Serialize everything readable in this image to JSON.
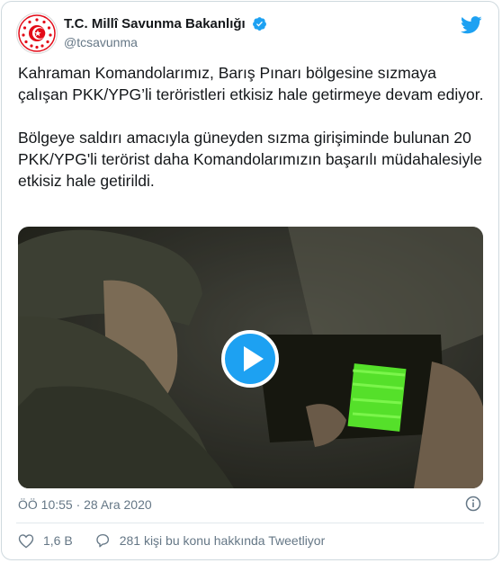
{
  "account": {
    "display_name": "T.C. Millî Savunma Bakanlığı",
    "handle": "@tcsavunma"
  },
  "tweet": {
    "paragraph_1": "Kahraman Komandolarımız, Barış Pınarı bölgesine sızmaya çalışan PKK/YPG’li teröristleri etkisiz hale getirmeye devam ediyor.",
    "paragraph_2": "Bölgeye saldırı amacıyla güneyden sızma girişiminde bulunan 20 PKK/YPG'li terörist daha Komandolarımızın başarılı müdahalesiyle etkisiz hale getirildi."
  },
  "media": {
    "type": "video"
  },
  "timestamp": "ÖÖ 10:55 · 28 Ara 2020",
  "actions": {
    "likes": "1,6 B",
    "conversation": "281 kişi bu konu hakkında Tweetliyor"
  },
  "icons": {
    "avatar": "ministry-emblem-icon",
    "verified": "verified-badge-icon",
    "brand": "twitter-bird-icon",
    "play": "play-icon",
    "info": "info-icon",
    "like": "heart-icon",
    "reply": "speech-bubble-icon"
  },
  "colors": {
    "accent": "#1da1f2",
    "text": "#14171a",
    "muted": "#657786",
    "border": "#e1e8ed",
    "emblem": "#e30a17"
  }
}
